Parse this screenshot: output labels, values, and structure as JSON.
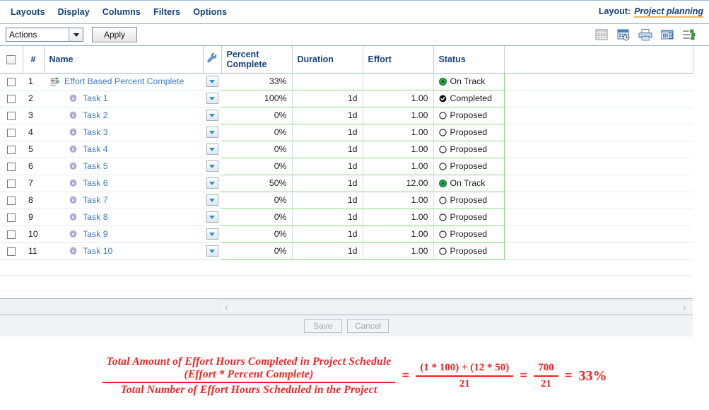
{
  "menu": {
    "items": [
      {
        "label": "Layouts",
        "name": "menu-layouts"
      },
      {
        "label": "Display",
        "name": "menu-display"
      },
      {
        "label": "Columns",
        "name": "menu-columns"
      },
      {
        "label": "Filters",
        "name": "menu-filters"
      },
      {
        "label": "Options",
        "name": "menu-options"
      }
    ],
    "layout_label": "Layout:",
    "layout_value": "Project planning"
  },
  "toolbar": {
    "action_select_value": "Actions",
    "apply_label": "Apply",
    "icons": [
      {
        "name": "grid-view-icon"
      },
      {
        "name": "schedule-calculate-icon"
      },
      {
        "name": "print-icon"
      },
      {
        "name": "column-layout-icon"
      },
      {
        "name": "outline-list-icon"
      }
    ]
  },
  "grid": {
    "columns": [
      {
        "key": "check",
        "label": ""
      },
      {
        "key": "num",
        "label": "#"
      },
      {
        "key": "name",
        "label": "Name"
      },
      {
        "key": "wrench",
        "label": ""
      },
      {
        "key": "percent",
        "label": "Percent\nComplete",
        "line1": "Percent",
        "line2": "Complete"
      },
      {
        "key": "duration",
        "label": "Duration"
      },
      {
        "key": "effort",
        "label": "Effort"
      },
      {
        "key": "status",
        "label": "Status"
      },
      {
        "key": "spare",
        "label": ""
      }
    ],
    "rows": [
      {
        "num": "1",
        "name": "Effort Based Percent Complete",
        "icon": "project-schedule-icon",
        "indent": false,
        "percent": "33%",
        "duration": "",
        "effort": "",
        "status": "On Track",
        "status_icon": "on-track-icon"
      },
      {
        "num": "2",
        "name": "Task 1",
        "icon": "task-gear-icon",
        "indent": true,
        "percent": "100%",
        "duration": "1d",
        "effort": "1.00",
        "status": "Completed",
        "status_icon": "completed-icon"
      },
      {
        "num": "3",
        "name": "Task 2",
        "icon": "task-gear-icon",
        "indent": true,
        "percent": "0%",
        "duration": "1d",
        "effort": "1.00",
        "status": "Proposed",
        "status_icon": "proposed-icon"
      },
      {
        "num": "4",
        "name": "Task 3",
        "icon": "task-gear-icon",
        "indent": true,
        "percent": "0%",
        "duration": "1d",
        "effort": "1.00",
        "status": "Proposed",
        "status_icon": "proposed-icon"
      },
      {
        "num": "5",
        "name": "Task 4",
        "icon": "task-gear-icon",
        "indent": true,
        "percent": "0%",
        "duration": "1d",
        "effort": "1.00",
        "status": "Proposed",
        "status_icon": "proposed-icon"
      },
      {
        "num": "6",
        "name": "Task 5",
        "icon": "task-gear-icon",
        "indent": true,
        "percent": "0%",
        "duration": "1d",
        "effort": "1.00",
        "status": "Proposed",
        "status_icon": "proposed-icon"
      },
      {
        "num": "7",
        "name": "Task 6",
        "icon": "task-gear-icon",
        "indent": true,
        "percent": "50%",
        "duration": "1d",
        "effort": "12.00",
        "status": "On Track",
        "status_icon": "on-track-icon"
      },
      {
        "num": "8",
        "name": "Task 7",
        "icon": "task-gear-icon",
        "indent": true,
        "percent": "0%",
        "duration": "1d",
        "effort": "1.00",
        "status": "Proposed",
        "status_icon": "proposed-icon"
      },
      {
        "num": "9",
        "name": "Task 8",
        "icon": "task-gear-icon",
        "indent": true,
        "percent": "0%",
        "duration": "1d",
        "effort": "1.00",
        "status": "Proposed",
        "status_icon": "proposed-icon"
      },
      {
        "num": "10",
        "name": "Task 9",
        "icon": "task-gear-icon",
        "indent": true,
        "percent": "0%",
        "duration": "1d",
        "effort": "1.00",
        "status": "Proposed",
        "status_icon": "proposed-icon"
      },
      {
        "num": "11",
        "name": "Task 10",
        "icon": "task-gear-icon",
        "indent": true,
        "percent": "0%",
        "duration": "1d",
        "effort": "1.00",
        "status": "Proposed",
        "status_icon": "proposed-icon"
      }
    ]
  },
  "scrollbar": {
    "left_arrow": "‹",
    "right_arrow": "›"
  },
  "footer": {
    "save_label": "Save",
    "cancel_label": "Cancel"
  },
  "formula": {
    "numerator_line1": "Total Amount of Effort Hours Completed in Project Schedule",
    "numerator_line2": "(Effort * Percent Complete)",
    "denominator": "Total Number of Effort Hours Scheduled in the Project",
    "equals_1": "=",
    "frac2_num": "(1 * 100) + (12 * 50)",
    "frac2_den": "21",
    "equals_2": "=",
    "frac3_num": "700",
    "frac3_den": "21",
    "equals_3": "=",
    "result": "33%"
  },
  "colors": {
    "menu_text": "#15417e",
    "link": "#3b7cc4",
    "editable_underline": "#87d77f",
    "formula_red": "#fc1f1f",
    "layout_underline": "#e8b96a"
  }
}
